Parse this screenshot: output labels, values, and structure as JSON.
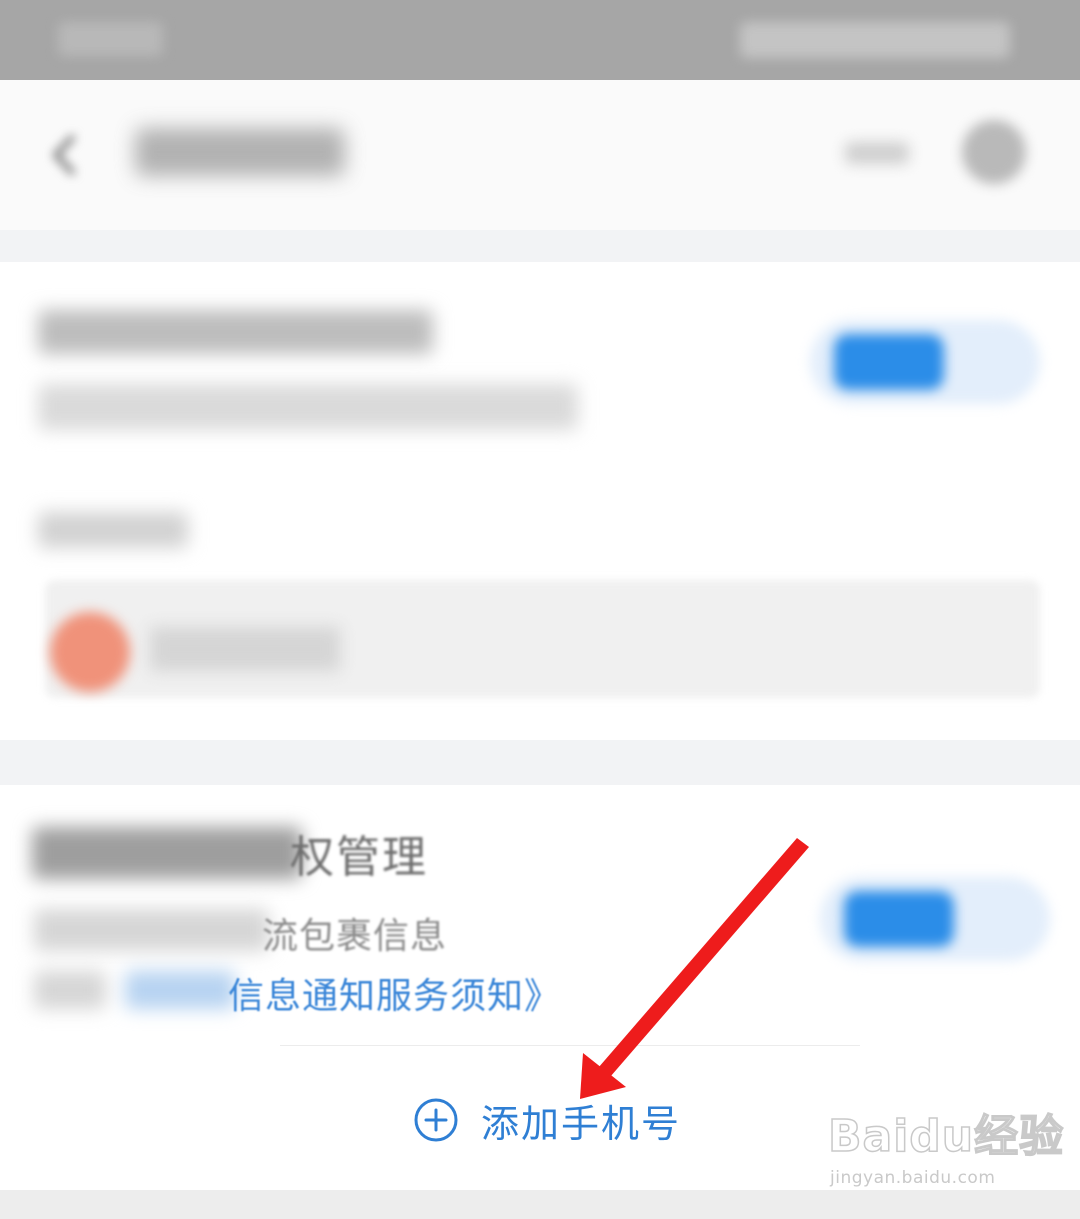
{
  "card2": {
    "heading_partial": "权管理",
    "description_partial": "流包裹信息",
    "link_partial": "信息通知服务须知》"
  },
  "add_phone": {
    "label": "添加手机号",
    "icon": "plus-circle-icon"
  },
  "watermark": {
    "brand": "Baidu经验",
    "url": "jingyan.baidu.com"
  },
  "colors": {
    "accent": "#2f7fd4",
    "toggle_on": "#2b8de8",
    "annotation_arrow": "#ee1c1c",
    "avatar": "#f0927a"
  },
  "toggles": {
    "first_on": true,
    "second_on": true
  }
}
